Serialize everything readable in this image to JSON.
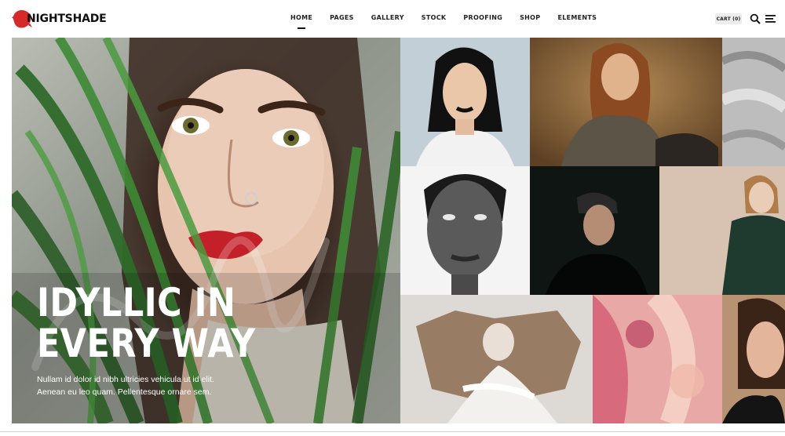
{
  "brand": {
    "name": "NIGHTSHADE",
    "accent": "#d42a2a"
  },
  "nav": {
    "items": [
      {
        "label": "HOME",
        "active": true
      },
      {
        "label": "PAGES",
        "active": false
      },
      {
        "label": "GALLERY",
        "active": false
      },
      {
        "label": "STOCK",
        "active": false
      },
      {
        "label": "PROOFING",
        "active": false
      },
      {
        "label": "SHOP",
        "active": false
      },
      {
        "label": "ELEMENTS",
        "active": false
      }
    ],
    "cart_label": "CART (0)",
    "search_icon": "search-icon",
    "menu_icon": "hamburger-menu-icon"
  },
  "hero": {
    "title_line1": "IDYLLIC IN",
    "title_line2": "EVERY WAY",
    "text_line1": "Nullam id dolor id nibh ultricies vehicula ut id elit.",
    "text_line2": "Aenean eu leo quam. Pellentesque ornare sem."
  }
}
